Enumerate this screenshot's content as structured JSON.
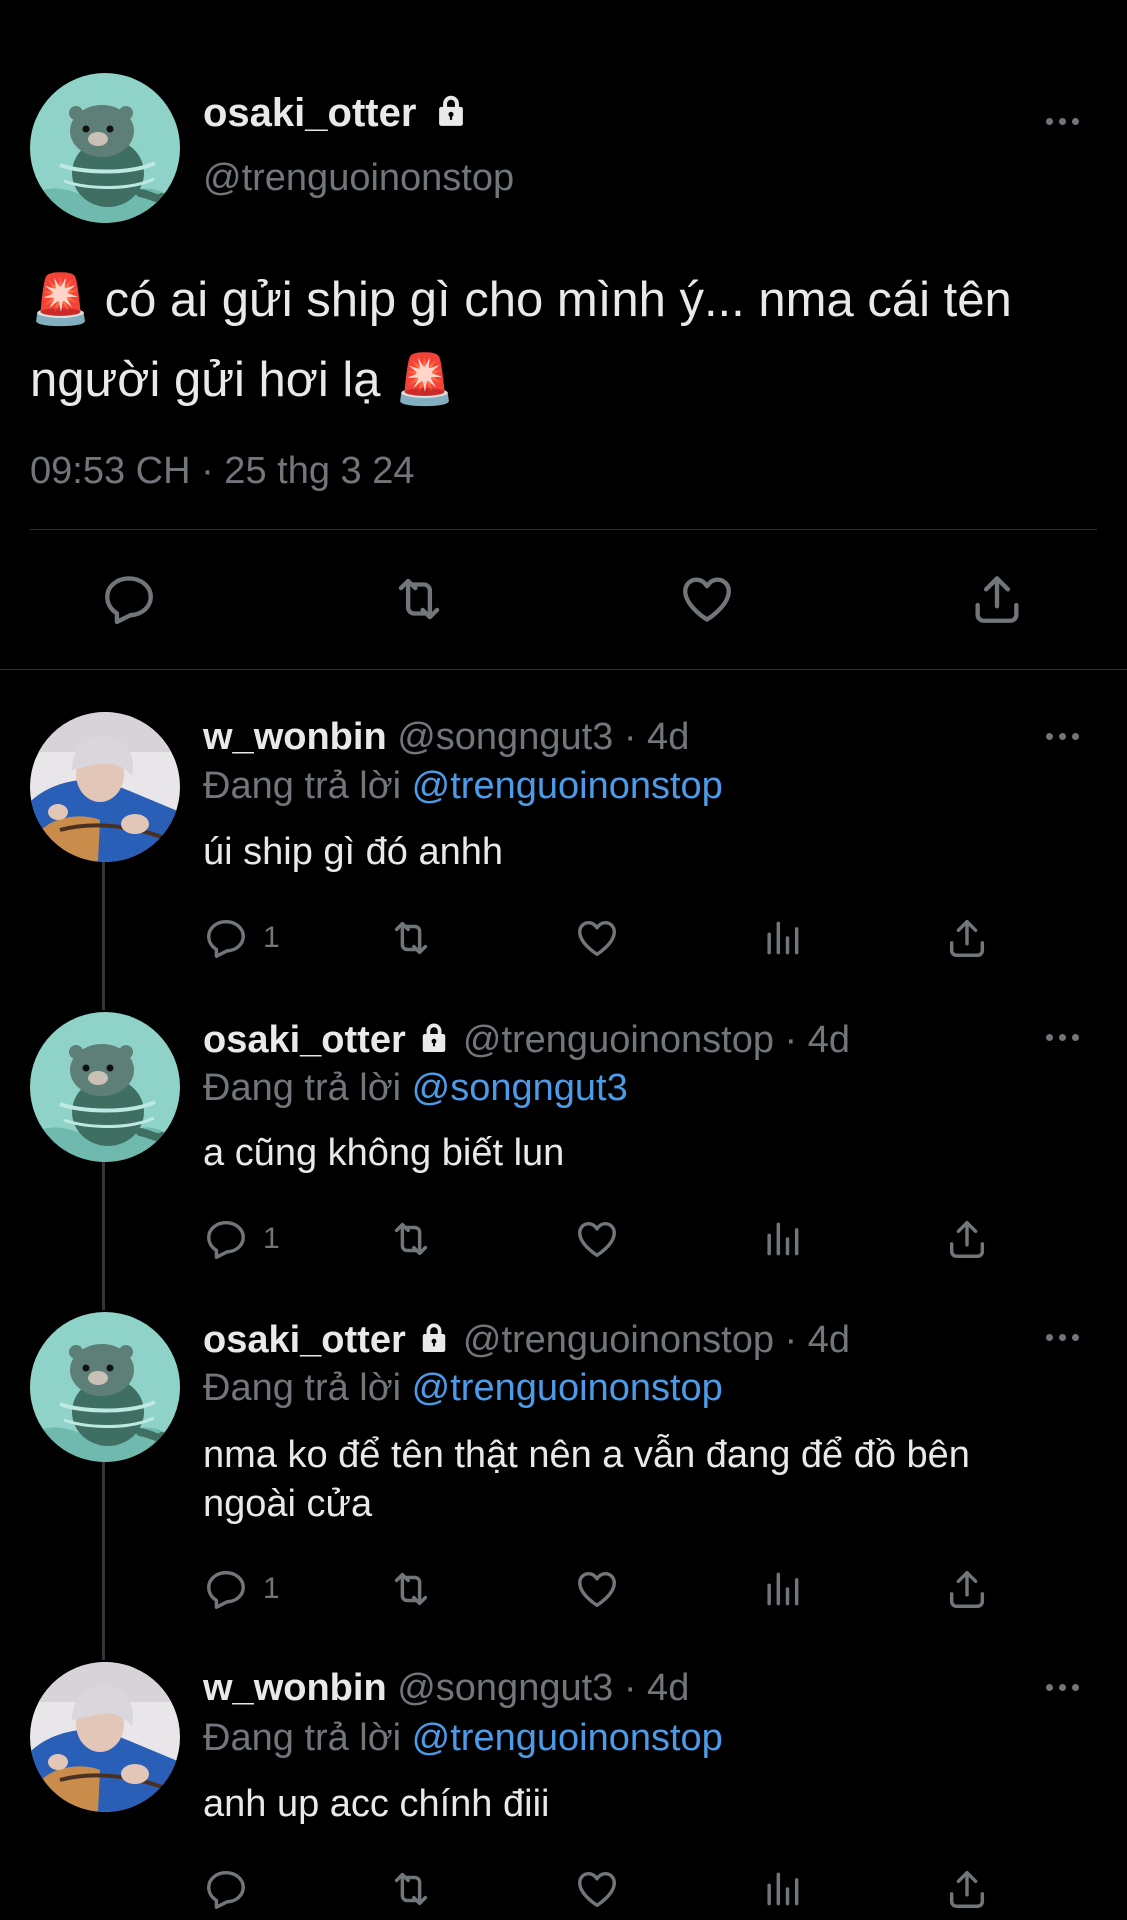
{
  "main_tweet": {
    "display_name": "osaki_otter",
    "handle": "@trenguoinonstop",
    "text_line1": "🚨 có ai gửi ship gì cho mình ý... nma cái tên",
    "text_line2": "người gửi hơi lạ 🚨",
    "timestamp": "09:53 CH · 25 thg 3 24"
  },
  "replies": [
    {
      "display_name": "w_wonbin",
      "handle_time": "@songngut3 · 4d",
      "reply_prefix": "Đang trả lời",
      "reply_to": "@trenguoinonstop",
      "text": "úi ship gì đó anhh",
      "reply_count": "1"
    },
    {
      "display_name": "osaki_otter",
      "handle_time": "@trenguoinonstop · 4d",
      "reply_prefix": "Đang trả lời",
      "reply_to": "@songngut3",
      "text": "a cũng không biết lun",
      "reply_count": "1"
    },
    {
      "display_name": "osaki_otter",
      "handle_time": "@trenguoinonstop · 4d",
      "reply_prefix": "Đang trả lời",
      "reply_to": "@trenguoinonstop",
      "text_line1": "nma ko để tên thật nên a vẫn đang để đồ bên",
      "text_line2": "ngoài cửa",
      "reply_count": "1"
    },
    {
      "display_name": "w_wonbin",
      "handle_time": "@songngut3 · 4d",
      "reply_prefix": "Đang trả lời",
      "reply_to": "@trenguoinonstop",
      "text": "anh up acc chính điii"
    }
  ],
  "colors": {
    "background": "#000000",
    "text": "#e7e9ea",
    "secondary": "#71767b",
    "link": "#4b9be8",
    "otter_avatar_bg": "#8fd3c8",
    "wonbin_avatar_shirt": "#2a5fb8"
  },
  "icons": [
    "lock-icon",
    "more-icon",
    "reply-icon",
    "retweet-icon",
    "like-icon",
    "views-icon",
    "share-icon"
  ]
}
